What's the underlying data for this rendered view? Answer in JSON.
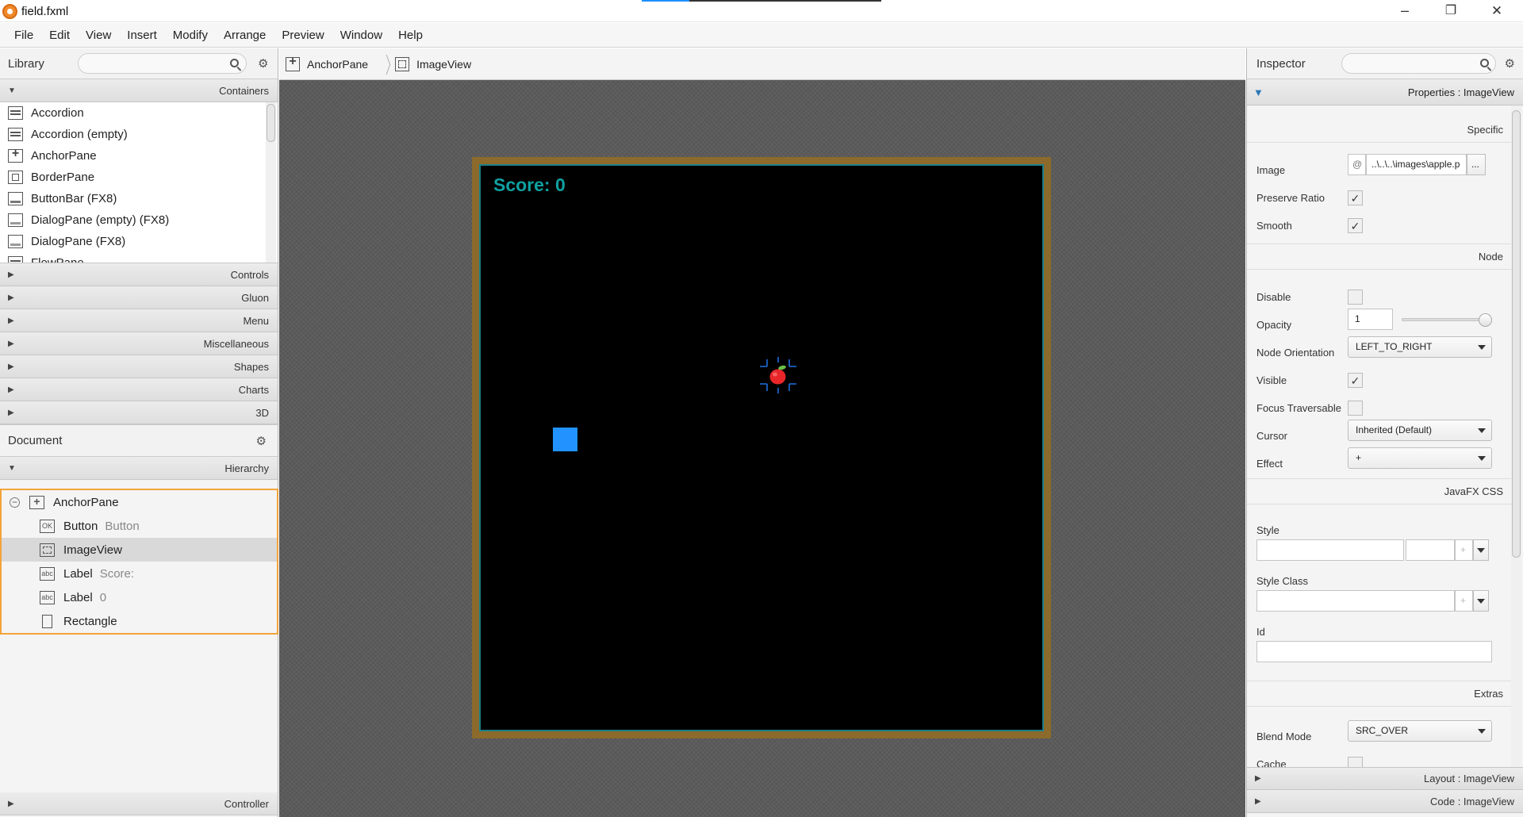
{
  "window": {
    "title": "field.fxml",
    "min": "–",
    "max": "❐",
    "close": "✕"
  },
  "menu": [
    "File",
    "Edit",
    "View",
    "Insert",
    "Modify",
    "Arrange",
    "Preview",
    "Window",
    "Help"
  ],
  "library": {
    "title": "Library",
    "sections": {
      "containers": "Containers",
      "controls": "Controls",
      "gluon": "Gluon",
      "menu": "Menu",
      "misc": "Miscellaneous",
      "shapes": "Shapes",
      "charts": "Charts",
      "threed": "3D"
    },
    "items": [
      {
        "name": "Accordion",
        "icon": "accordion-icon"
      },
      {
        "name": "Accordion  (empty)",
        "icon": "accordion-icon"
      },
      {
        "name": "AnchorPane",
        "icon": "anchorpane-icon"
      },
      {
        "name": "BorderPane",
        "icon": "borderpane-icon"
      },
      {
        "name": "ButtonBar  (FX8)",
        "icon": "buttonbar-icon"
      },
      {
        "name": "DialogPane (empty)  (FX8)",
        "icon": "dialogpane-icon"
      },
      {
        "name": "DialogPane  (FX8)",
        "icon": "dialogpane-icon"
      },
      {
        "name": "FlowPane",
        "icon": "flowpane-icon"
      }
    ]
  },
  "document": {
    "title": "Document",
    "hierarchy_label": "Hierarchy",
    "controller_label": "Controller",
    "tree": [
      {
        "label": "AnchorPane",
        "sub": "",
        "icon": "+"
      },
      {
        "label": "Button",
        "sub": "Button",
        "icon": "OK"
      },
      {
        "label": "ImageView",
        "sub": "",
        "icon": ""
      },
      {
        "label": "Label",
        "sub": "Score:",
        "icon": "abc"
      },
      {
        "label": "Label",
        "sub": "0",
        "icon": "abc"
      },
      {
        "label": "Rectangle",
        "sub": "",
        "icon": ""
      }
    ]
  },
  "breadcrumb": [
    "AnchorPane",
    "ImageView"
  ],
  "canvas": {
    "score_text": "Score: 0"
  },
  "inspector": {
    "title": "Inspector",
    "properties_header": "Properties : ImageView",
    "sections": {
      "specific": "Specific",
      "node": "Node",
      "css": "JavaFX CSS",
      "extras": "Extras"
    },
    "labels": {
      "image": "Image",
      "preserve_ratio": "Preserve Ratio",
      "smooth": "Smooth",
      "disable": "Disable",
      "opacity": "Opacity",
      "node_orientation": "Node Orientation",
      "visible": "Visible",
      "focus_traversable": "Focus Traversable",
      "cursor": "Cursor",
      "effect": "Effect",
      "style": "Style",
      "style_class": "Style Class",
      "id": "Id",
      "blend_mode": "Blend Mode",
      "cache": "Cache"
    },
    "values": {
      "image": "..\\..\\..\\images\\apple.p",
      "image_btn": "...",
      "opacity": "1",
      "opacity_level": 1.0,
      "node_orientation": "LEFT_TO_RIGHT",
      "cursor": "Inherited (Default)",
      "effect": "+",
      "blend_mode": "SRC_OVER",
      "preserve_ratio": true,
      "smooth": true,
      "disable": false,
      "visible": true,
      "focus_traversable": false,
      "cache": false
    },
    "layout_header": "Layout : ImageView",
    "code_header": "Code : ImageView"
  },
  "colors": {
    "accent": "#f2a33a",
    "field_border": "#8b6a2b",
    "score": "#10a0a0",
    "snake": "#2192ff",
    "apple": "#e8262a"
  }
}
